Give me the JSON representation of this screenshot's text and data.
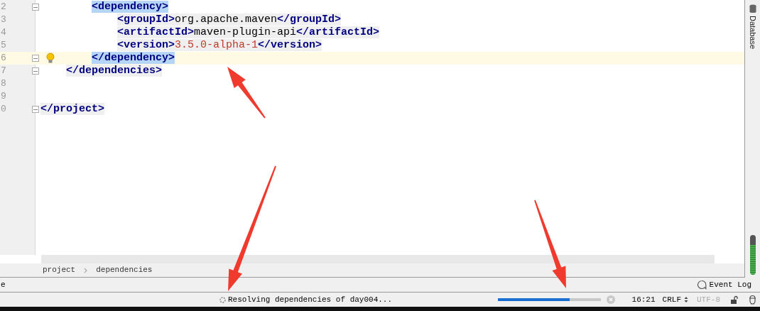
{
  "editor": {
    "lines": [
      {
        "number": "2",
        "fold": true,
        "current": false,
        "bulb": false,
        "tokens": [
          {
            "kind": "tag",
            "matched": true,
            "text": "        <dependency>"
          }
        ]
      },
      {
        "number": "3",
        "fold": false,
        "current": false,
        "bulb": false,
        "tokens": [
          {
            "kind": "tag",
            "matched": false,
            "text": "            <groupId>"
          },
          {
            "kind": "text",
            "text": "org.apache.maven"
          },
          {
            "kind": "tag",
            "matched": false,
            "text": "</groupId>"
          }
        ]
      },
      {
        "number": "4",
        "fold": false,
        "current": false,
        "bulb": false,
        "tokens": [
          {
            "kind": "tag",
            "matched": false,
            "text": "            <artifactId>"
          },
          {
            "kind": "text",
            "text": "maven-plugin-api"
          },
          {
            "kind": "tag",
            "matched": false,
            "text": "</artifactId>"
          }
        ]
      },
      {
        "number": "5",
        "fold": false,
        "current": false,
        "bulb": false,
        "tokens": [
          {
            "kind": "tag",
            "matched": false,
            "text": "            <version>"
          },
          {
            "kind": "value",
            "text": "3.5.0-alpha-1"
          },
          {
            "kind": "tag",
            "matched": false,
            "text": "</version>"
          }
        ]
      },
      {
        "number": "6",
        "fold": true,
        "current": true,
        "bulb": true,
        "tokens": [
          {
            "kind": "tag",
            "matched": true,
            "text": "        </dependency>"
          }
        ]
      },
      {
        "number": "7",
        "fold": true,
        "current": false,
        "bulb": false,
        "tokens": [
          {
            "kind": "tag",
            "matched": false,
            "text": "    </dependencies>"
          }
        ]
      },
      {
        "number": "8",
        "fold": false,
        "current": false,
        "bulb": false
      },
      {
        "number": "9",
        "fold": false,
        "current": false,
        "bulb": false
      },
      {
        "number": "0",
        "fold": true,
        "current": false,
        "bulb": false,
        "tokens": [
          {
            "kind": "tag",
            "matched": false,
            "text": "</project>"
          }
        ]
      }
    ]
  },
  "right_sidebar": {
    "label": "Database"
  },
  "breadcrumbs": [
    "project",
    "dependencies"
  ],
  "tool_bar": {
    "left_label": "e",
    "event_log": "Event Log"
  },
  "status_bar": {
    "message": "Resolving dependencies of day004...",
    "progress": {
      "level": 0.7
    },
    "position": "16:21",
    "line_separator": "CRLF",
    "encoding": {
      "text": "UTF-8",
      "disabled": true
    }
  }
}
